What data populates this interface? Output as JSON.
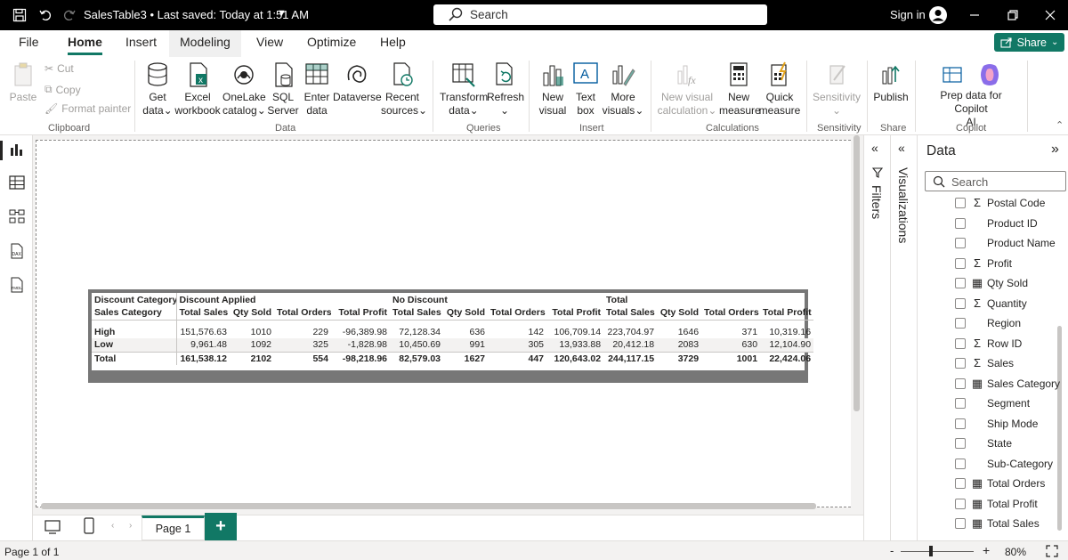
{
  "titlebar": {
    "title": "SalesTable3 • Last saved: Today at 1:51 AM",
    "search_label": "Search",
    "signin_label": "Sign in"
  },
  "tabs": [
    {
      "label": "File"
    },
    {
      "label": "Home"
    },
    {
      "label": "Insert"
    },
    {
      "label": "Modeling"
    },
    {
      "label": "View"
    },
    {
      "label": "Optimize"
    },
    {
      "label": "Help"
    }
  ],
  "share_label": "Share",
  "ribbon": {
    "clipboard": {
      "paste": "Paste",
      "cut": "Cut",
      "copy": "Copy",
      "format_painter": "Format painter",
      "group": "Clipboard"
    },
    "data": {
      "get_data_1": "Get",
      "get_data_2": "data",
      "excel_1": "Excel",
      "excel_2": "workbook",
      "onelake_1": "OneLake",
      "onelake_2": "catalog",
      "sql_1": "SQL",
      "sql_2": "Server",
      "enter_1": "Enter",
      "enter_2": "data",
      "dataverse": "Dataverse",
      "recent_1": "Recent",
      "recent_2": "sources",
      "group": "Data"
    },
    "queries": {
      "transform_1": "Transform",
      "transform_2": "data",
      "refresh": "Refresh",
      "group": "Queries"
    },
    "insert": {
      "new_visual_1": "New",
      "new_visual_2": "visual",
      "text_box_1": "Text",
      "text_box_2": "box",
      "more_visuals_1": "More",
      "more_visuals_2": "visuals",
      "group": "Insert"
    },
    "calculations": {
      "new_visual_calc_1": "New visual",
      "new_visual_calc_2": "calculation",
      "new_measure_1": "New",
      "new_measure_2": "measure",
      "quick_measure_1": "Quick",
      "quick_measure_2": "measure",
      "group": "Calculations"
    },
    "sensitivity": {
      "label": "Sensitivity",
      "group": "Sensitivity"
    },
    "share": {
      "publish": "Publish",
      "group": "Share"
    },
    "copilot": {
      "prep_1": "Prep data for Copilot",
      "prep_2": "AI",
      "group": "Copilot"
    }
  },
  "matrix": {
    "row_header_1": "Discount Category",
    "row_header_2": "Sales Category",
    "col_groups": [
      "Discount Applied",
      "No Discount",
      "Total"
    ],
    "measures": [
      "Total Sales",
      "Qty Sold",
      "Total Orders",
      "Total Profit"
    ],
    "rows": [
      {
        "label": "High",
        "values": [
          "151,576.63",
          "1010",
          "229",
          "-96,389.98",
          "72,128.34",
          "636",
          "142",
          "106,709.14",
          "223,704.97",
          "1646",
          "371",
          "10,319.16"
        ]
      },
      {
        "label": "Low",
        "values": [
          "9,961.48",
          "1092",
          "325",
          "-1,828.98",
          "10,450.69",
          "991",
          "305",
          "13,933.88",
          "20,412.18",
          "2083",
          "630",
          "12,104.90"
        ]
      },
      {
        "label": "Total",
        "values": [
          "161,538.12",
          "2102",
          "554",
          "-98,218.96",
          "82,579.03",
          "1627",
          "447",
          "120,643.02",
          "244,117.15",
          "3729",
          "1001",
          "22,424.06"
        ]
      }
    ]
  },
  "pages": [
    {
      "label": "Page 1"
    }
  ],
  "add_page_label": "+",
  "status": {
    "page_indicator": "Page 1 of 1",
    "zoom": "80%",
    "zoom_minus": "-",
    "zoom_plus": "+"
  },
  "panes": {
    "filters": "Filters",
    "visualizations": "Visualizations",
    "data_title": "Data",
    "data_search_placeholder": "Search"
  },
  "fields": [
    {
      "name": "Postal Code",
      "type": "sigma"
    },
    {
      "name": "Product ID",
      "type": "none"
    },
    {
      "name": "Product Name",
      "type": "none"
    },
    {
      "name": "Profit",
      "type": "sigma"
    },
    {
      "name": "Qty Sold",
      "type": "calc"
    },
    {
      "name": "Quantity",
      "type": "sigma"
    },
    {
      "name": "Region",
      "type": "none"
    },
    {
      "name": "Row ID",
      "type": "sigma"
    },
    {
      "name": "Sales",
      "type": "sigma"
    },
    {
      "name": "Sales Category",
      "type": "calc-column"
    },
    {
      "name": "Segment",
      "type": "none"
    },
    {
      "name": "Ship Mode",
      "type": "none"
    },
    {
      "name": "State",
      "type": "none"
    },
    {
      "name": "Sub-Category",
      "type": "none"
    },
    {
      "name": "Total Orders",
      "type": "calc"
    },
    {
      "name": "Total Profit",
      "type": "calc"
    },
    {
      "name": "Total Sales",
      "type": "calc"
    }
  ],
  "colors": {
    "accent": "#117865",
    "titlebar": "#000000"
  }
}
